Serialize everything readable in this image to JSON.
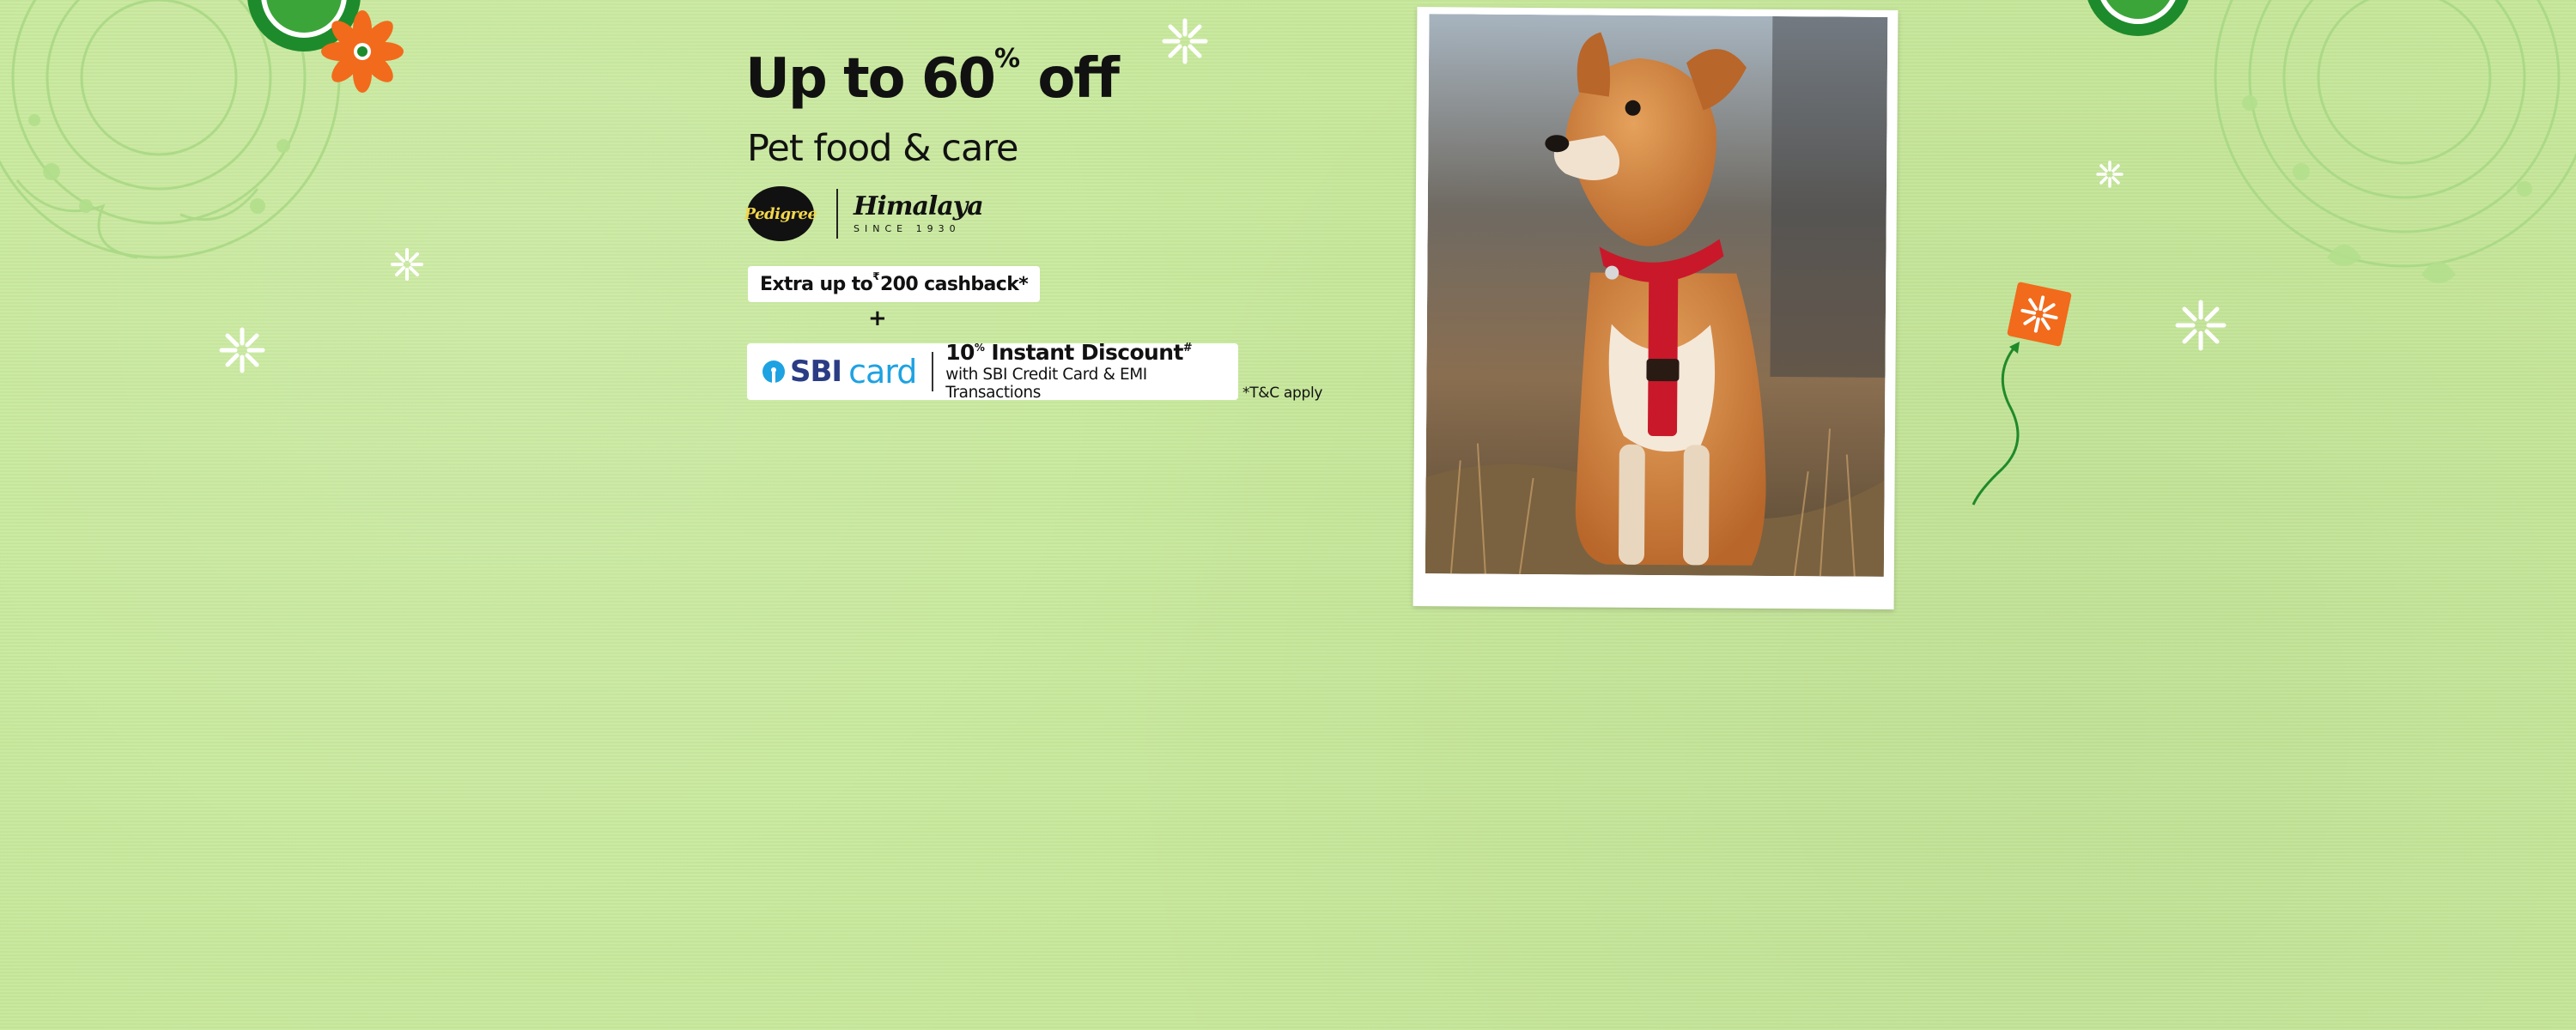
{
  "banner": {
    "headline_main": "Up to 60",
    "headline_pct": "%",
    "headline_end": " off",
    "subtitle": "Pet food & care",
    "brands": {
      "pedigree": "Pedigree",
      "himalaya": "Himalaya",
      "himalaya_since": "SINCE 1930"
    },
    "cashback": {
      "prefix": "Extra up to ",
      "currency": "₹",
      "amount": "200 cashback*"
    },
    "plus": "+",
    "bank_offer": {
      "logo_sbi": "SBI",
      "logo_card": "card",
      "pct_value": "10",
      "pct_symbol": "%",
      "label": " Instant Discount",
      "mark": "#",
      "sub": "with SBI Credit Card & EMI Transactions"
    },
    "tnc": "*T&C apply"
  },
  "colors": {
    "background": "#c7e89b",
    "accent_orange": "#f26a1b",
    "accent_green": "#1f8a2a",
    "sbi_blue": "#1ea2e2",
    "sbi_navy": "#2a3c84"
  },
  "icons": [
    "flower-icon",
    "sparkle-icon",
    "kite-icon",
    "mandala-icon",
    "dog-photo"
  ]
}
